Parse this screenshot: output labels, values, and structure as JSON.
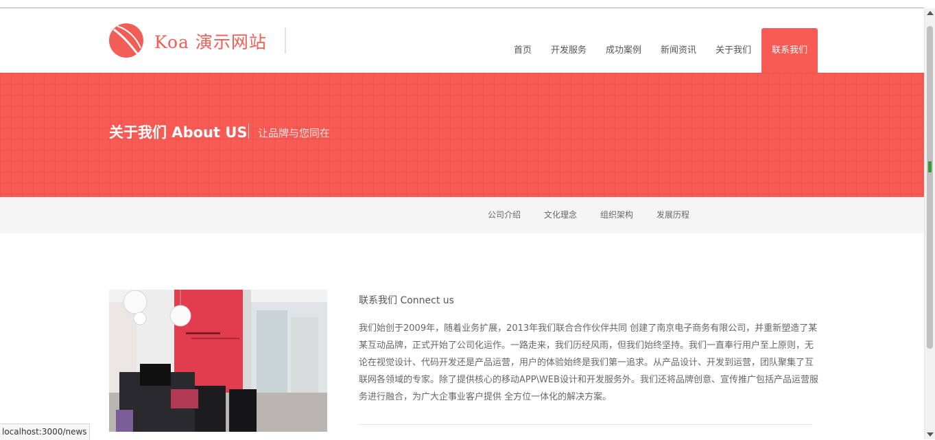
{
  "header": {
    "logo_text": "Koa 演示网站",
    "nav": [
      {
        "label": "首页",
        "active": false
      },
      {
        "label": "开发服务",
        "active": false
      },
      {
        "label": "成功案例",
        "active": false
      },
      {
        "label": "新闻资讯",
        "active": false
      },
      {
        "label": "关于我们",
        "active": false
      },
      {
        "label": "联系我们",
        "active": true
      }
    ]
  },
  "banner": {
    "title": "关于我们 About US",
    "subtitle": "让品牌与您同在"
  },
  "subnav": {
    "items": [
      "公司介绍",
      "文化理念",
      "组织架构",
      "发展历程"
    ]
  },
  "content": {
    "title": "联系我们 Connect us",
    "body": "我们始创于2009年，随着业务扩展，2013年我们联合合作伙伴共同 创建了南京电子商务有限公司，并重新塑造了某某互动品牌，正式开始了公司化运作。一路走来，我们历经风雨，但我们始终坚持。我们一直奉行用户至上原则，无论在视觉设计、代码开发还是产品运营，用户的体验始终是我们第一追求。从产品设计、开发到运营，团队聚集了互联网各领域的专家。除了提供核心的移动APP\\WEB设计和开发服务外。我们还将品牌创意、宣传推广包括产品运营服务进行融合，为广大企事业客户提供 全方位一体化的解决方案。"
  },
  "status_bar": {
    "url": "localhost:3000/news"
  },
  "colors": {
    "accent": "#f85a54",
    "subnav_bg": "#f5f5f5"
  }
}
